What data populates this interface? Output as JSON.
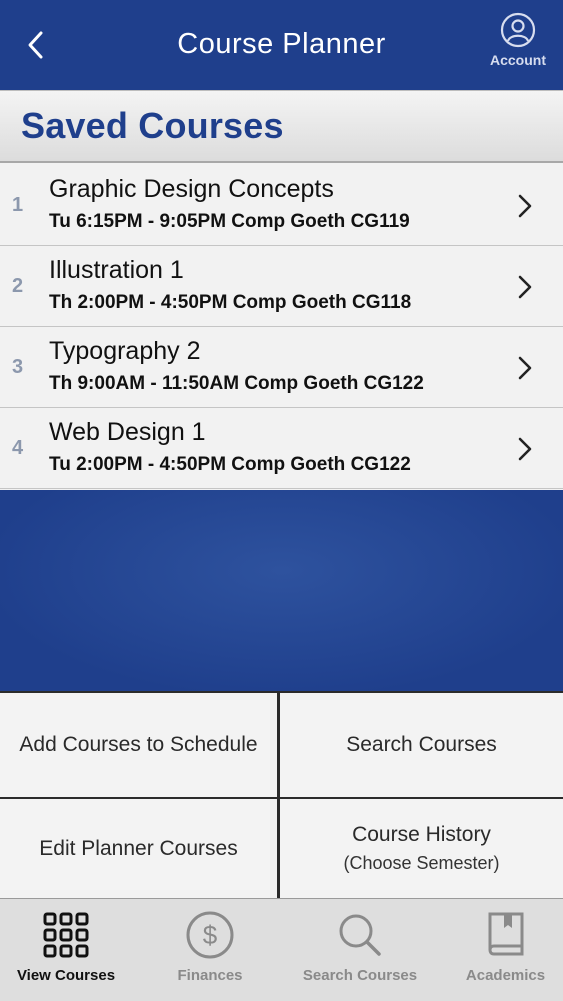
{
  "header": {
    "title": "Course Planner",
    "account_label": "Account"
  },
  "section": {
    "title": "Saved Courses"
  },
  "courses": [
    {
      "num": "1",
      "name": "Graphic Design Concepts",
      "time": "Tu 6:15PM - 9:05PM Comp Goeth CG119"
    },
    {
      "num": "2",
      "name": "Illustration 1",
      "time": "Th 2:00PM - 4:50PM Comp Goeth CG118"
    },
    {
      "num": "3",
      "name": "Typography 2",
      "time": "Th 9:00AM - 11:50AM Comp Goeth CG122"
    },
    {
      "num": "4",
      "name": "Web Design 1",
      "time": "Tu 2:00PM - 4:50PM Comp Goeth CG122"
    }
  ],
  "actions": {
    "add_courses": "Add Courses to Schedule",
    "search_courses": "Search Courses",
    "edit_planner": "Edit Planner Courses",
    "course_history": "Course History",
    "course_history_sub": "(Choose Semester)"
  },
  "tabs": [
    {
      "label": "View Courses",
      "icon": "grid-icon",
      "active": true
    },
    {
      "label": "Finances",
      "icon": "dollar-icon",
      "active": false
    },
    {
      "label": "Search Courses",
      "icon": "search-icon",
      "active": false
    },
    {
      "label": "Academics",
      "icon": "book-icon",
      "active": false
    }
  ],
  "colors": {
    "brand_blue": "#1f3f8c",
    "muted_gray": "#8a8a8a"
  }
}
